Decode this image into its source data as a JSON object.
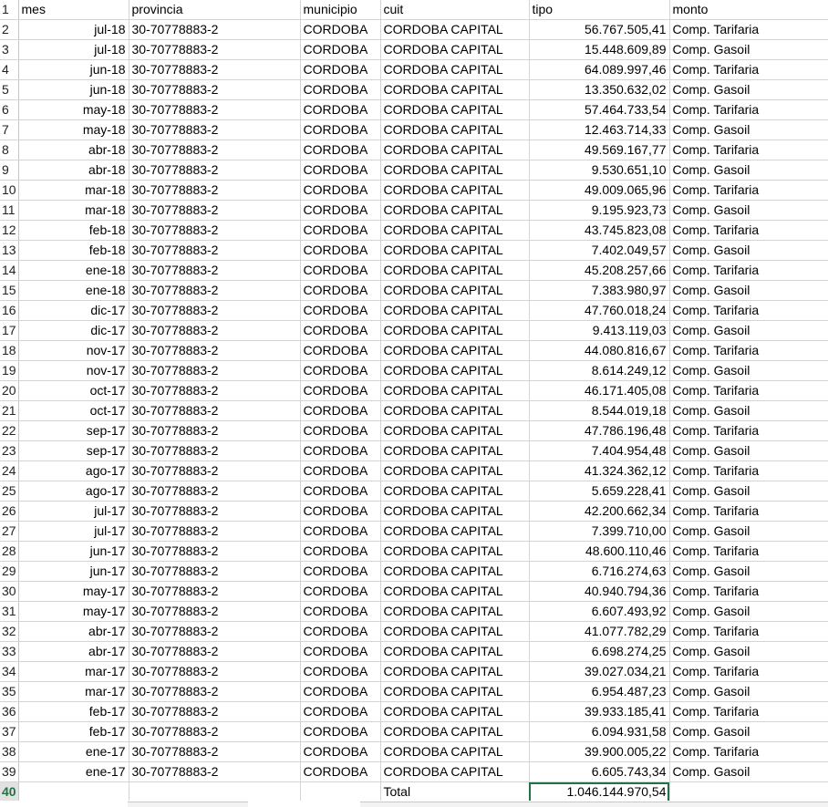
{
  "header": [
    "mes",
    "provincia",
    "municipio",
    "cuit",
    "tipo",
    "monto"
  ],
  "rows": [
    [
      "jul-18",
      "30-70778883-2",
      "CORDOBA",
      "CORDOBA CAPITAL",
      "56.767.505,41",
      "Comp. Tarifaria"
    ],
    [
      "jul-18",
      "30-70778883-2",
      "CORDOBA",
      "CORDOBA CAPITAL",
      "15.448.609,89",
      "Comp. Gasoil"
    ],
    [
      "jun-18",
      "30-70778883-2",
      "CORDOBA",
      "CORDOBA CAPITAL",
      "64.089.997,46",
      "Comp. Tarifaria"
    ],
    [
      "jun-18",
      "30-70778883-2",
      "CORDOBA",
      "CORDOBA CAPITAL",
      "13.350.632,02",
      "Comp. Gasoil"
    ],
    [
      "may-18",
      "30-70778883-2",
      "CORDOBA",
      "CORDOBA CAPITAL",
      "57.464.733,54",
      "Comp. Tarifaria"
    ],
    [
      "may-18",
      "30-70778883-2",
      "CORDOBA",
      "CORDOBA CAPITAL",
      "12.463.714,33",
      "Comp. Gasoil"
    ],
    [
      "abr-18",
      "30-70778883-2",
      "CORDOBA",
      "CORDOBA CAPITAL",
      "49.569.167,77",
      "Comp. Tarifaria"
    ],
    [
      "abr-18",
      "30-70778883-2",
      "CORDOBA",
      "CORDOBA CAPITAL",
      "9.530.651,10",
      "Comp. Gasoil"
    ],
    [
      "mar-18",
      "30-70778883-2",
      "CORDOBA",
      "CORDOBA CAPITAL",
      "49.009.065,96",
      "Comp. Tarifaria"
    ],
    [
      "mar-18",
      "30-70778883-2",
      "CORDOBA",
      "CORDOBA CAPITAL",
      "9.195.923,73",
      "Comp. Gasoil"
    ],
    [
      "feb-18",
      "30-70778883-2",
      "CORDOBA",
      "CORDOBA CAPITAL",
      "43.745.823,08",
      "Comp. Tarifaria"
    ],
    [
      "feb-18",
      "30-70778883-2",
      "CORDOBA",
      "CORDOBA CAPITAL",
      "7.402.049,57",
      "Comp. Gasoil"
    ],
    [
      "ene-18",
      "30-70778883-2",
      "CORDOBA",
      "CORDOBA CAPITAL",
      "45.208.257,66",
      "Comp. Tarifaria"
    ],
    [
      "ene-18",
      "30-70778883-2",
      "CORDOBA",
      "CORDOBA CAPITAL",
      "7.383.980,97",
      "Comp. Gasoil"
    ],
    [
      "dic-17",
      "30-70778883-2",
      "CORDOBA",
      "CORDOBA CAPITAL",
      "47.760.018,24",
      "Comp. Tarifaria"
    ],
    [
      "dic-17",
      "30-70778883-2",
      "CORDOBA",
      "CORDOBA CAPITAL",
      "9.413.119,03",
      "Comp. Gasoil"
    ],
    [
      "nov-17",
      "30-70778883-2",
      "CORDOBA",
      "CORDOBA CAPITAL",
      "44.080.816,67",
      "Comp. Tarifaria"
    ],
    [
      "nov-17",
      "30-70778883-2",
      "CORDOBA",
      "CORDOBA CAPITAL",
      "8.614.249,12",
      "Comp. Gasoil"
    ],
    [
      "oct-17",
      "30-70778883-2",
      "CORDOBA",
      "CORDOBA CAPITAL",
      "46.171.405,08",
      "Comp. Tarifaria"
    ],
    [
      "oct-17",
      "30-70778883-2",
      "CORDOBA",
      "CORDOBA CAPITAL",
      "8.544.019,18",
      "Comp. Gasoil"
    ],
    [
      "sep-17",
      "30-70778883-2",
      "CORDOBA",
      "CORDOBA CAPITAL",
      "47.786.196,48",
      "Comp. Tarifaria"
    ],
    [
      "sep-17",
      "30-70778883-2",
      "CORDOBA",
      "CORDOBA CAPITAL",
      "7.404.954,48",
      "Comp. Gasoil"
    ],
    [
      "ago-17",
      "30-70778883-2",
      "CORDOBA",
      "CORDOBA CAPITAL",
      "41.324.362,12",
      "Comp. Tarifaria"
    ],
    [
      "ago-17",
      "30-70778883-2",
      "CORDOBA",
      "CORDOBA CAPITAL",
      "5.659.228,41",
      "Comp. Gasoil"
    ],
    [
      "jul-17",
      "30-70778883-2",
      "CORDOBA",
      "CORDOBA CAPITAL",
      "42.200.662,34",
      "Comp. Tarifaria"
    ],
    [
      "jul-17",
      "30-70778883-2",
      "CORDOBA",
      "CORDOBA CAPITAL",
      "7.399.710,00",
      "Comp. Gasoil"
    ],
    [
      "jun-17",
      "30-70778883-2",
      "CORDOBA",
      "CORDOBA CAPITAL",
      "48.600.110,46",
      "Comp. Tarifaria"
    ],
    [
      "jun-17",
      "30-70778883-2",
      "CORDOBA",
      "CORDOBA CAPITAL",
      "6.716.274,63",
      "Comp. Gasoil"
    ],
    [
      "may-17",
      "30-70778883-2",
      "CORDOBA",
      "CORDOBA CAPITAL",
      "40.940.794,36",
      "Comp. Tarifaria"
    ],
    [
      "may-17",
      "30-70778883-2",
      "CORDOBA",
      "CORDOBA CAPITAL",
      "6.607.493,92",
      "Comp. Gasoil"
    ],
    [
      "abr-17",
      "30-70778883-2",
      "CORDOBA",
      "CORDOBA CAPITAL",
      "41.077.782,29",
      "Comp. Tarifaria"
    ],
    [
      "abr-17",
      "30-70778883-2",
      "CORDOBA",
      "CORDOBA CAPITAL",
      "6.698.274,25",
      "Comp. Gasoil"
    ],
    [
      "mar-17",
      "30-70778883-2",
      "CORDOBA",
      "CORDOBA CAPITAL",
      "39.027.034,21",
      "Comp. Tarifaria"
    ],
    [
      "mar-17",
      "30-70778883-2",
      "CORDOBA",
      "CORDOBA CAPITAL",
      "6.954.487,23",
      "Comp. Gasoil"
    ],
    [
      "feb-17",
      "30-70778883-2",
      "CORDOBA",
      "CORDOBA CAPITAL",
      "39.933.185,41",
      "Comp. Tarifaria"
    ],
    [
      "feb-17",
      "30-70778883-2",
      "CORDOBA",
      "CORDOBA CAPITAL",
      "6.094.931,58",
      "Comp. Gasoil"
    ],
    [
      "ene-17",
      "30-70778883-2",
      "CORDOBA",
      "CORDOBA CAPITAL",
      "39.900.005,22",
      "Comp. Tarifaria"
    ],
    [
      "ene-17",
      "30-70778883-2",
      "CORDOBA",
      "CORDOBA CAPITAL",
      "6.605.743,34",
      "Comp. Gasoil"
    ]
  ],
  "total": {
    "label": "Total",
    "value": "1.046.144.970,54"
  },
  "colors": {
    "accent": "#217346",
    "gridline": "#d4d4d4"
  }
}
